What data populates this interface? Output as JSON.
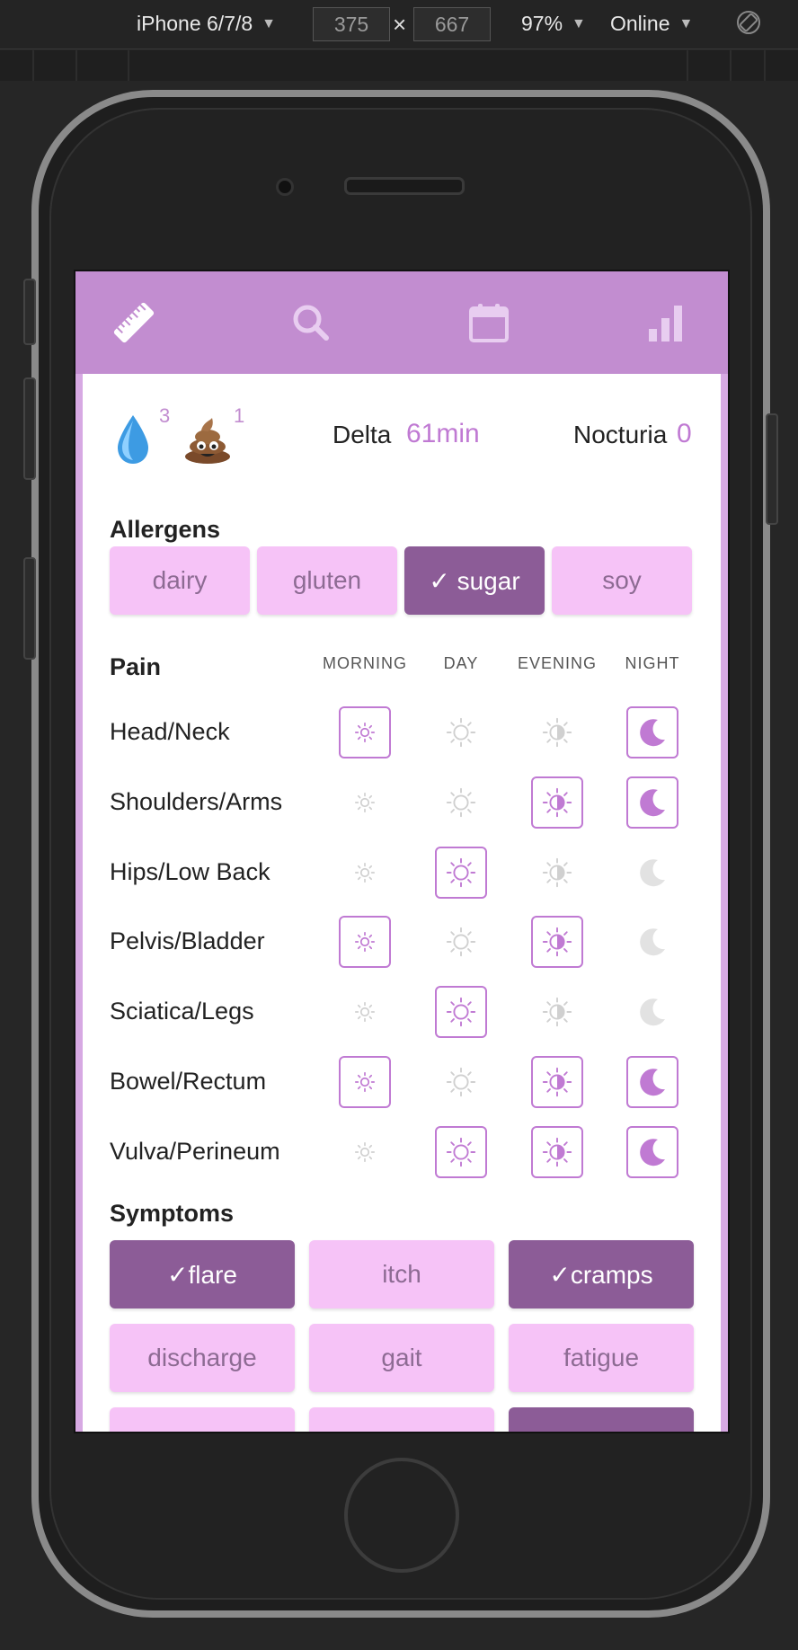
{
  "devtools": {
    "device": "iPhone 6/7/8",
    "width": "375",
    "height": "667",
    "times": "×",
    "zoom": "97%",
    "network": "Online"
  },
  "colors": {
    "header": "#c28dd0",
    "chip_off": "#f6c3f7",
    "chip_on": "#8c5c97",
    "accent": "#c07ad3"
  },
  "nav": [
    "ruler-icon",
    "search-icon",
    "calendar-icon",
    "bar-chart-icon"
  ],
  "summary": {
    "drop_count": "3",
    "poop_count": "1",
    "delta_label": "Delta",
    "delta_value": "61min",
    "nocturia_label": "Nocturia",
    "nocturia_value": "0"
  },
  "allergens": {
    "title": "Allergens",
    "items": [
      {
        "label": "dairy",
        "selected": false
      },
      {
        "label": "gluten",
        "selected": false
      },
      {
        "label": "✓ sugar",
        "selected": true
      },
      {
        "label": "soy",
        "selected": false
      }
    ]
  },
  "pain": {
    "title": "Pain",
    "columns": [
      "MORNING",
      "DAY",
      "EVENING",
      "NIGHT"
    ],
    "rows": [
      {
        "label": "Head/Neck",
        "active": [
          true,
          false,
          false,
          true
        ]
      },
      {
        "label": "Shoulders/Arms",
        "active": [
          false,
          false,
          true,
          true
        ]
      },
      {
        "label": "Hips/Low Back",
        "active": [
          false,
          true,
          false,
          false
        ]
      },
      {
        "label": "Pelvis/Bladder",
        "active": [
          true,
          false,
          true,
          false
        ]
      },
      {
        "label": "Sciatica/Legs",
        "active": [
          false,
          true,
          false,
          false
        ]
      },
      {
        "label": "Bowel/Rectum",
        "active": [
          true,
          false,
          true,
          true
        ]
      },
      {
        "label": "Vulva/Perineum",
        "active": [
          false,
          true,
          true,
          true
        ]
      }
    ]
  },
  "symptoms": {
    "title": "Symptoms",
    "items": [
      {
        "label": "✓flare",
        "selected": true
      },
      {
        "label": "itch",
        "selected": false
      },
      {
        "label": "✓cramps",
        "selected": true
      },
      {
        "label": "discharge",
        "selected": false
      },
      {
        "label": "gait",
        "selected": false
      },
      {
        "label": "fatigue",
        "selected": false
      },
      {
        "label": "",
        "selected": false
      },
      {
        "label": "",
        "selected": false
      },
      {
        "label": "",
        "selected": true
      }
    ]
  }
}
